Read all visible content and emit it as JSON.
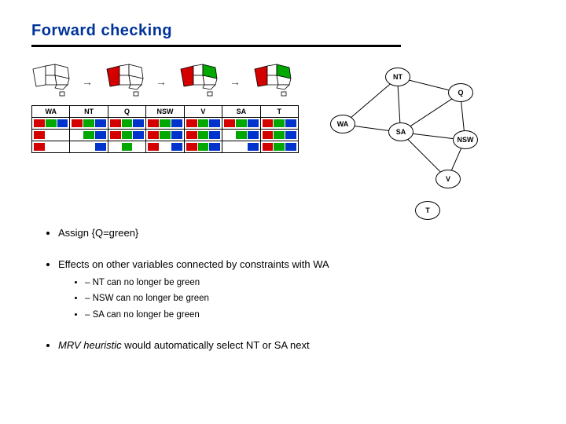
{
  "title": "Forward checking",
  "regions": [
    "WA",
    "NT",
    "Q",
    "NSW",
    "V",
    "SA",
    "T"
  ],
  "domain_rows": [
    [
      [
        "r",
        "g",
        "b"
      ],
      [
        "r",
        "g",
        "b"
      ],
      [
        "r",
        "g",
        "b"
      ],
      [
        "r",
        "g",
        "b"
      ],
      [
        "r",
        "g",
        "b"
      ],
      [
        "r",
        "g",
        "b"
      ],
      [
        "r",
        "g",
        "b"
      ]
    ],
    [
      [
        "r",
        "e",
        "e"
      ],
      [
        "e",
        "g",
        "b"
      ],
      [
        "r",
        "g",
        "b"
      ],
      [
        "r",
        "g",
        "b"
      ],
      [
        "r",
        "g",
        "b"
      ],
      [
        "e",
        "g",
        "b"
      ],
      [
        "r",
        "g",
        "b"
      ]
    ],
    [
      [
        "r",
        "e",
        "e"
      ],
      [
        "e",
        "e",
        "b"
      ],
      [
        "e",
        "g",
        "e"
      ],
      [
        "r",
        "e",
        "b"
      ],
      [
        "r",
        "g",
        "b"
      ],
      [
        "e",
        "e",
        "b"
      ],
      [
        "r",
        "g",
        "b"
      ]
    ]
  ],
  "bullet1_prefix": "Assign ",
  "bullet1_set": "{Q=green}",
  "bullet2": "Effects on other variables connected by constraints with WA",
  "sub1": "NT can no longer be green",
  "sub2": "NSW can no longer be green",
  "sub3": "SA can no longer be green",
  "bullet3_prefix": "MRV heuristic",
  "bullet3_rest": " would automatically select NT or SA next",
  "graph_nodes": [
    "WA",
    "NT",
    "SA",
    "Q",
    "NSW",
    "V",
    "T"
  ]
}
